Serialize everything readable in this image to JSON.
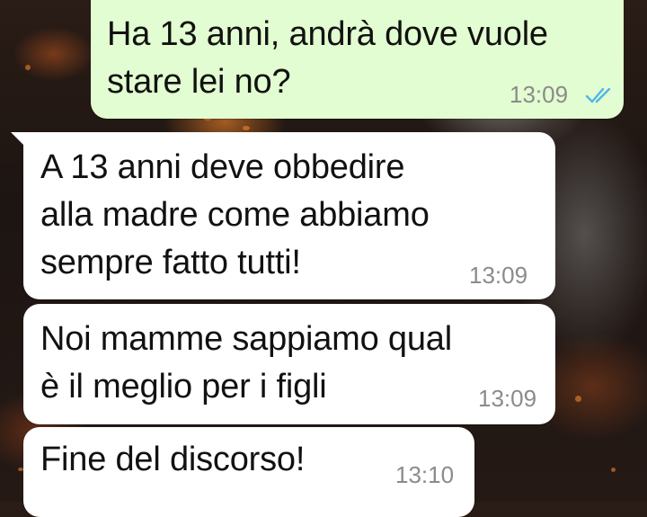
{
  "chat": {
    "messages": [
      {
        "direction": "outgoing",
        "text": "Ha 13 anni, andrà dove vuole\nstare lei no?",
        "time": "13:09",
        "status": "read",
        "status_icon": "double-check-icon"
      },
      {
        "direction": "incoming",
        "text": "A 13 anni deve obbedire\nalla madre come abbiamo\nsempre fatto tutti!",
        "time": "13:09"
      },
      {
        "direction": "incoming",
        "text": "Noi mamme sappiamo qual\nè il meglio per i figli",
        "time": "13:09"
      },
      {
        "direction": "incoming",
        "text": "Fine del discorso!",
        "time": "13:10"
      }
    ]
  },
  "colors": {
    "outgoing_bubble": "#e2fdd1",
    "incoming_bubble": "#ffffff",
    "read_ticks": "#4fb6ec",
    "timestamp": "#8b8b8b"
  }
}
